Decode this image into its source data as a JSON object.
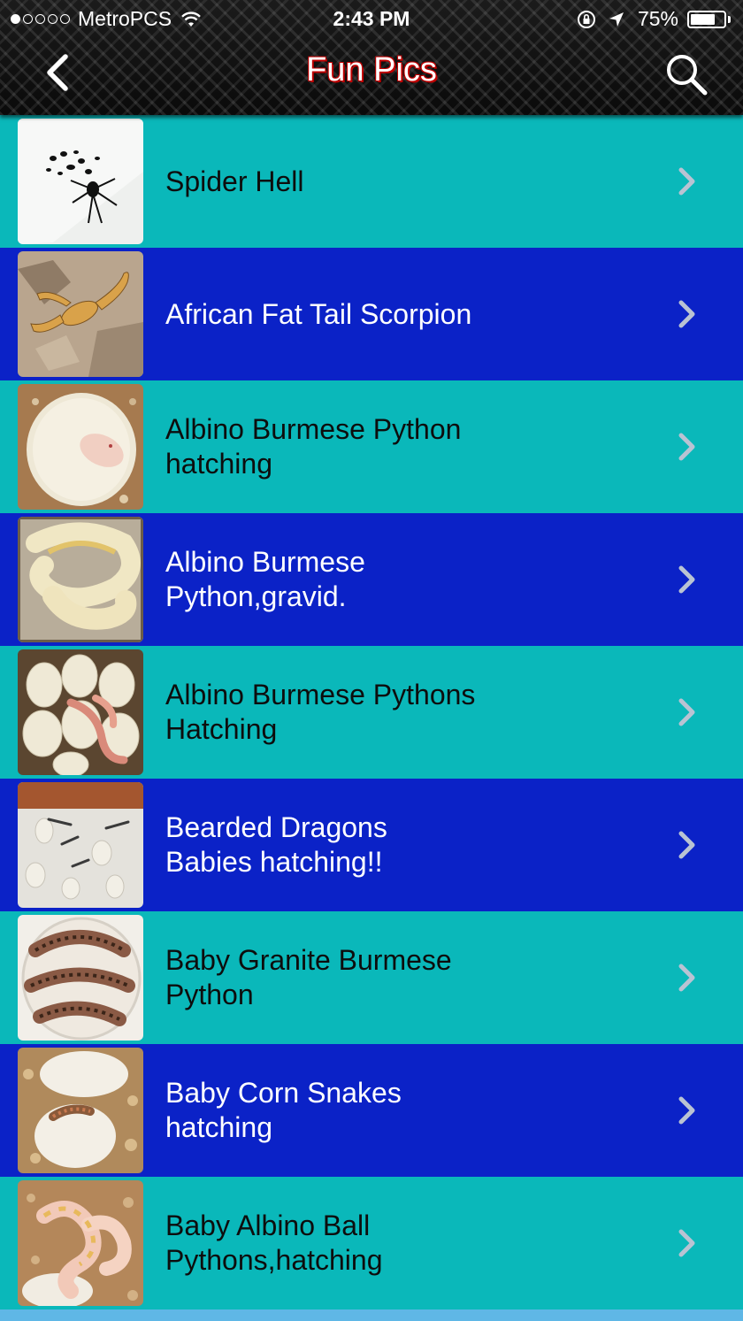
{
  "status_bar": {
    "carrier": "MetroPCS",
    "signal_dots_filled": 1,
    "signal_dots_total": 5,
    "time": "2:43 PM",
    "battery_percent": "75%",
    "battery_level": 0.75
  },
  "nav": {
    "title": "Fun Pics",
    "back_icon": "chevron-left-icon",
    "search_icon": "search-icon"
  },
  "items": [
    {
      "line1": "Spider Hell",
      "line2": ""
    },
    {
      "line1": "African Fat Tail Scorpion",
      "line2": ""
    },
    {
      "line1": "Albino Burmese Python",
      "line2": "hatching"
    },
    {
      "line1": "Albino Burmese",
      "line2": "Python,gravid."
    },
    {
      "line1": "Albino Burmese Pythons",
      "line2": "Hatching"
    },
    {
      "line1": "Bearded Dragons",
      "line2": "Babies hatching!!"
    },
    {
      "line1": "Baby Granite Burmese",
      "line2": "Python"
    },
    {
      "line1": "Baby Corn Snakes",
      "line2": "hatching"
    },
    {
      "line1": "Baby Albino Ball",
      "line2": "Pythons,hatching"
    }
  ],
  "colors": {
    "row_teal": "#0ab8ba",
    "row_blue": "#0b22c7",
    "title_outline": "#c00000",
    "chevron": "#b9c3d3"
  }
}
